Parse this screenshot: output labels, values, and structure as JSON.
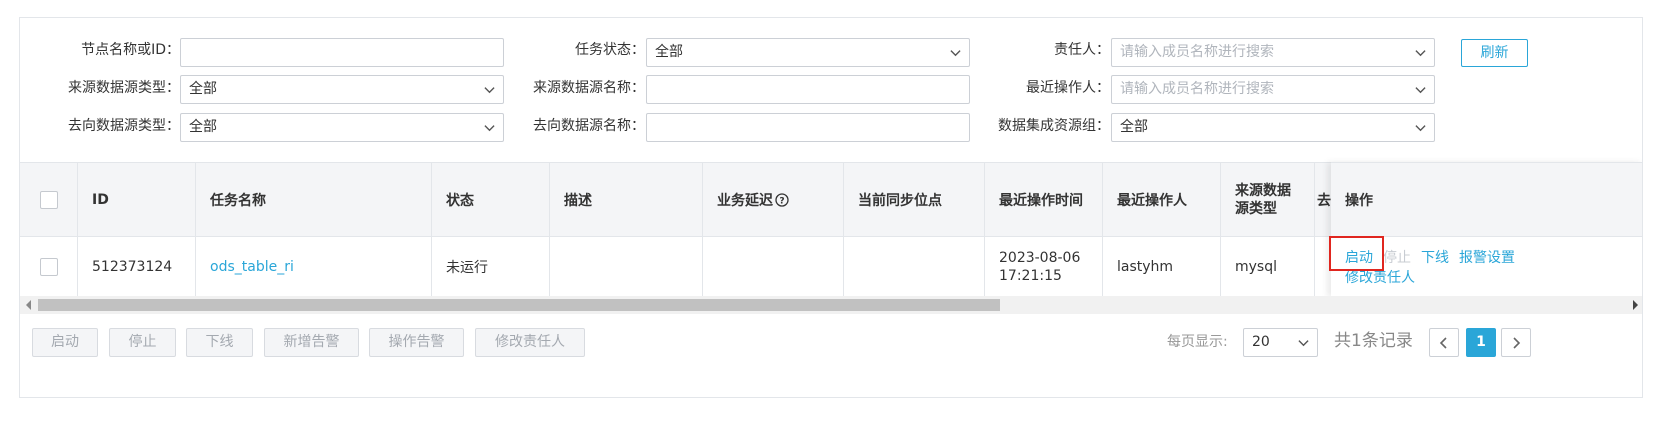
{
  "filters": {
    "node_name_label": "节点名称或ID：",
    "node_name_value": "",
    "task_status_label": "任务状态：",
    "task_status_value": "全部",
    "owner_label": "责任人：",
    "owner_placeholder": "请输入成员名称进行搜索",
    "refresh_label": "刷新",
    "source_type_label": "来源数据源类型：",
    "source_type_value": "全部",
    "source_name_label": "来源数据源名称：",
    "source_name_value": "",
    "last_operator_label": "最近操作人：",
    "last_operator_placeholder": "请输入成员名称进行搜索",
    "target_type_label": "去向数据源类型：",
    "target_type_value": "全部",
    "target_name_label": "去向数据源名称：",
    "target_name_value": "",
    "resource_group_label": "数据集成资源组：",
    "resource_group_value": "全部"
  },
  "table": {
    "columns": [
      "ID",
      "任务名称",
      "状态",
      "描述",
      "业务延迟",
      "当前同步位点",
      "最近操作时间",
      "最近操作人",
      "来源数据源类型",
      "操作"
    ],
    "source_type_header_line1": "来源数据",
    "source_type_header_line2": "源类型",
    "hidden_col_fragment": "去",
    "rows": [
      {
        "id": "512373124",
        "name": "ods_table_ri",
        "status": "未运行",
        "description": "",
        "delay": "",
        "sync_point": "",
        "op_time_line1": "2023-08-06",
        "op_time_line2": "17:21:15",
        "operator": "lastyhm",
        "source_type": "mysql"
      }
    ],
    "row_actions": {
      "start": "启动",
      "stop": "停止",
      "offline": "下线",
      "alert_settings": "报警设置",
      "change_owner": "修改责任人"
    }
  },
  "footer": {
    "buttons": [
      "启动",
      "停止",
      "下线",
      "新增告警",
      "操作告警",
      "修改责任人"
    ],
    "page_size_label": "每页显示:",
    "page_size_value": "20",
    "total_text": "共1条记录",
    "current_page": "1"
  },
  "colors": {
    "accent": "#2aa6d8",
    "highlight": "#e0261f"
  }
}
